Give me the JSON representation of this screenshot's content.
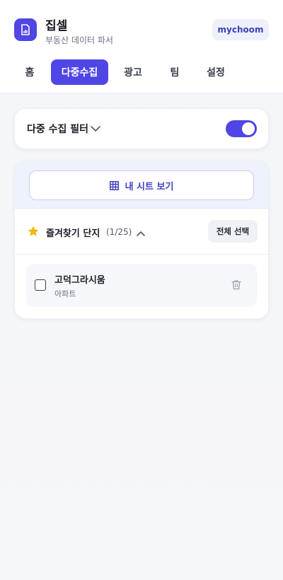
{
  "app": {
    "title": "집셀",
    "subtitle": "부동산 데이터 파서",
    "user": "mychoom",
    "logo_icon": "document-chart-icon"
  },
  "nav": {
    "tabs": [
      {
        "label": "홈",
        "active": false
      },
      {
        "label": "다중수집",
        "active": true
      },
      {
        "label": "광고",
        "active": false
      },
      {
        "label": "팀",
        "active": false
      },
      {
        "label": "설정",
        "active": false
      }
    ]
  },
  "filter": {
    "label": "다중 수집 필터",
    "toggle_on": true
  },
  "sheet": {
    "button_label": "내 시트 보기",
    "icon": "grid-table-icon"
  },
  "favorites": {
    "title": "즐겨찾기 단지",
    "count": "(1/25)",
    "select_all_label": "전체 선택",
    "items": [
      {
        "name": "고덕그라시움",
        "type": "아파트",
        "checked": false
      }
    ]
  },
  "colors": {
    "accent": "#4f46e5",
    "star": "#f2b705",
    "background": "#f4f5f8"
  }
}
